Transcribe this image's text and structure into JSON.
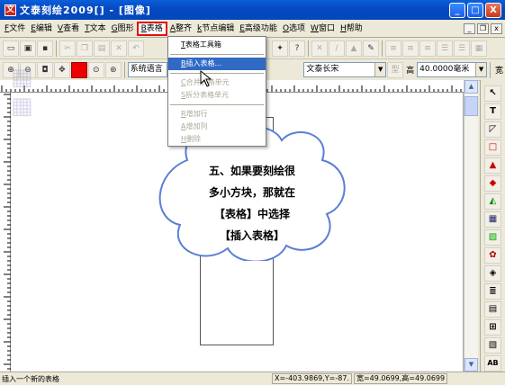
{
  "window": {
    "title": "文泰刻绘2009[] - [图像]",
    "icon_glyph": "文",
    "min": "_",
    "max": "□",
    "close": "X"
  },
  "menu": {
    "items": [
      {
        "acc": "F",
        "label": "文件"
      },
      {
        "acc": "E",
        "label": "编辑"
      },
      {
        "acc": "V",
        "label": "查看"
      },
      {
        "acc": "T",
        "label": "文本"
      },
      {
        "acc": "G",
        "label": "图形"
      },
      {
        "acc": "B",
        "label": "表格"
      },
      {
        "acc": "A",
        "label": "整齐"
      },
      {
        "acc": "k",
        "label": "节点编辑"
      },
      {
        "acc": "E",
        "label": "高级功能"
      },
      {
        "acc": "O",
        "label": "选项"
      },
      {
        "acc": "W",
        "label": "窗口"
      },
      {
        "acc": "H",
        "label": "帮助"
      }
    ],
    "mdi_min": "_",
    "mdi_restore": "❐",
    "mdi_close": "x"
  },
  "toolbar2": {
    "font_category": "系统语言",
    "font_name": "文泰长宋",
    "height_label": "高",
    "height_value": "40.0000毫米",
    "width_label": "宽"
  },
  "table_menu": {
    "toolbar_item": "表格工具箱",
    "toolbar_acc": "T",
    "insert": "插入表格...",
    "insert_acc": "B",
    "merge": "合并表格单元",
    "merge_acc": "C",
    "split": "拆分表格单元",
    "split_acc": "S",
    "add_row": "增加行",
    "add_row_acc": "R",
    "add_col": "增加列",
    "add_col_acc": "A",
    "delete": "删除",
    "delete_acc": "H"
  },
  "annotation": {
    "line1": "五、如果要刻绘很",
    "line2": "多小方块，那就在",
    "line3": "【表格】中选择",
    "line4": "【插入表格】"
  },
  "status": {
    "message": "插入一个新的表格",
    "coords": "X=-403.9869,Y=-87.",
    "size": "宽=49.0699,高=49.0699"
  },
  "colors": {
    "cloud_stroke": "#5b7fd6",
    "title_bar": "#0549c2",
    "menu_highlight": "#316ac5"
  }
}
